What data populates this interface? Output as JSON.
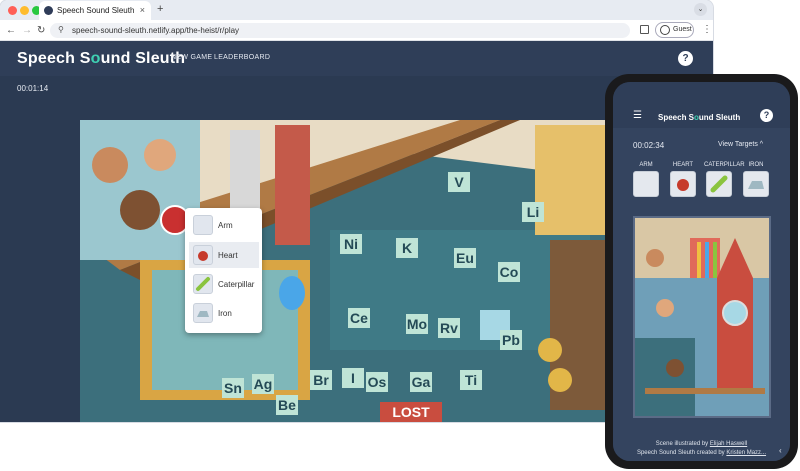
{
  "browser": {
    "tab_title": "Speech Sound Sleuth",
    "tab_close": "×",
    "new_tab": "+",
    "url": "speech-sound-sleuth.netlify.app/the-heist/r/play",
    "profile_label": "Guest",
    "back_icon": "←",
    "forward_icon": "→",
    "reload_icon": "↻",
    "menu_icon": "⋮",
    "expand_icon": "⌄",
    "tune_icon": "⚲"
  },
  "app": {
    "logo_pre": "Speech S",
    "logo_mark": "o",
    "logo_post": "und Sleuth",
    "nav": [
      "NEW GAME",
      "LEADERBOARD"
    ],
    "help": "?",
    "timer": "00:01:14"
  },
  "popup": {
    "items": [
      {
        "label": "Arm"
      },
      {
        "label": "Heart"
      },
      {
        "label": "Caterpillar"
      },
      {
        "label": "Iron"
      }
    ],
    "highlighted": "Heart"
  },
  "scene_elements": [
    "V",
    "Ni",
    "K",
    "Eu",
    "Co",
    "Li",
    "Ce",
    "Mo",
    "Rv",
    "Pb",
    "Sn",
    "Ag",
    "Br",
    "I",
    "Os",
    "Ga",
    "Ti",
    "Be",
    "LOST"
  ],
  "phone": {
    "menu_icon": "☰",
    "logo_pre": "Speech S",
    "logo_mark": "o",
    "logo_post": "und Sleuth",
    "help": "?",
    "timer": "00:02:34",
    "view_targets": "View Targets ^",
    "targets": [
      {
        "label": "ARM"
      },
      {
        "label": "HEART"
      },
      {
        "label": "CATERPILLAR"
      },
      {
        "label": "IRON"
      }
    ],
    "credit1_pre": "Scene illustrated by ",
    "credit1_name": "Elijah Haswell",
    "credit2_pre": "Speech Sound Sleuth created by ",
    "credit2_name": "Kristen Mazz...",
    "collapse_icon": "‹"
  },
  "colors": {
    "header_bg": "#2f3e58",
    "accent": "#3fd0b2",
    "heart_red": "#c63a2b",
    "caterpillar_green": "#8ac43f"
  }
}
